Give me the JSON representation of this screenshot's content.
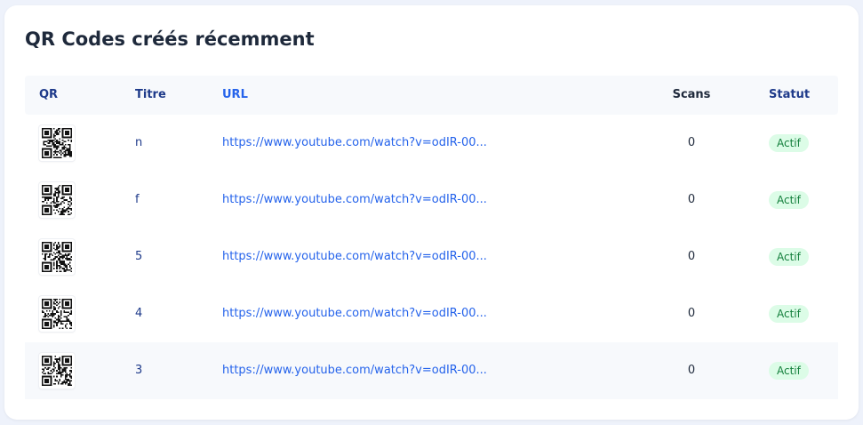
{
  "section": {
    "title": "QR Codes créés récemment"
  },
  "table": {
    "headers": {
      "qr": "QR",
      "title": "Titre",
      "url": "URL",
      "scans": "Scans",
      "status": "Statut"
    },
    "rows": [
      {
        "title": "n",
        "url": "https://www.youtube.com/watch?v=odIR-00...",
        "scans": "0",
        "status": "Actif"
      },
      {
        "title": "f",
        "url": "https://www.youtube.com/watch?v=odIR-00...",
        "scans": "0",
        "status": "Actif"
      },
      {
        "title": "5",
        "url": "https://www.youtube.com/watch?v=odIR-00...",
        "scans": "0",
        "status": "Actif"
      },
      {
        "title": "4",
        "url": "https://www.youtube.com/watch?v=odIR-00...",
        "scans": "0",
        "status": "Actif"
      },
      {
        "title": "3",
        "url": "https://www.youtube.com/watch?v=odIR-00...",
        "scans": "0",
        "status": "Actif"
      }
    ]
  },
  "colors": {
    "accent_text": "#1e3a8a",
    "link": "#2563eb",
    "status_bg": "#dcfce7",
    "status_text": "#15803d"
  },
  "icons": {
    "qr": "qr-code-icon"
  }
}
